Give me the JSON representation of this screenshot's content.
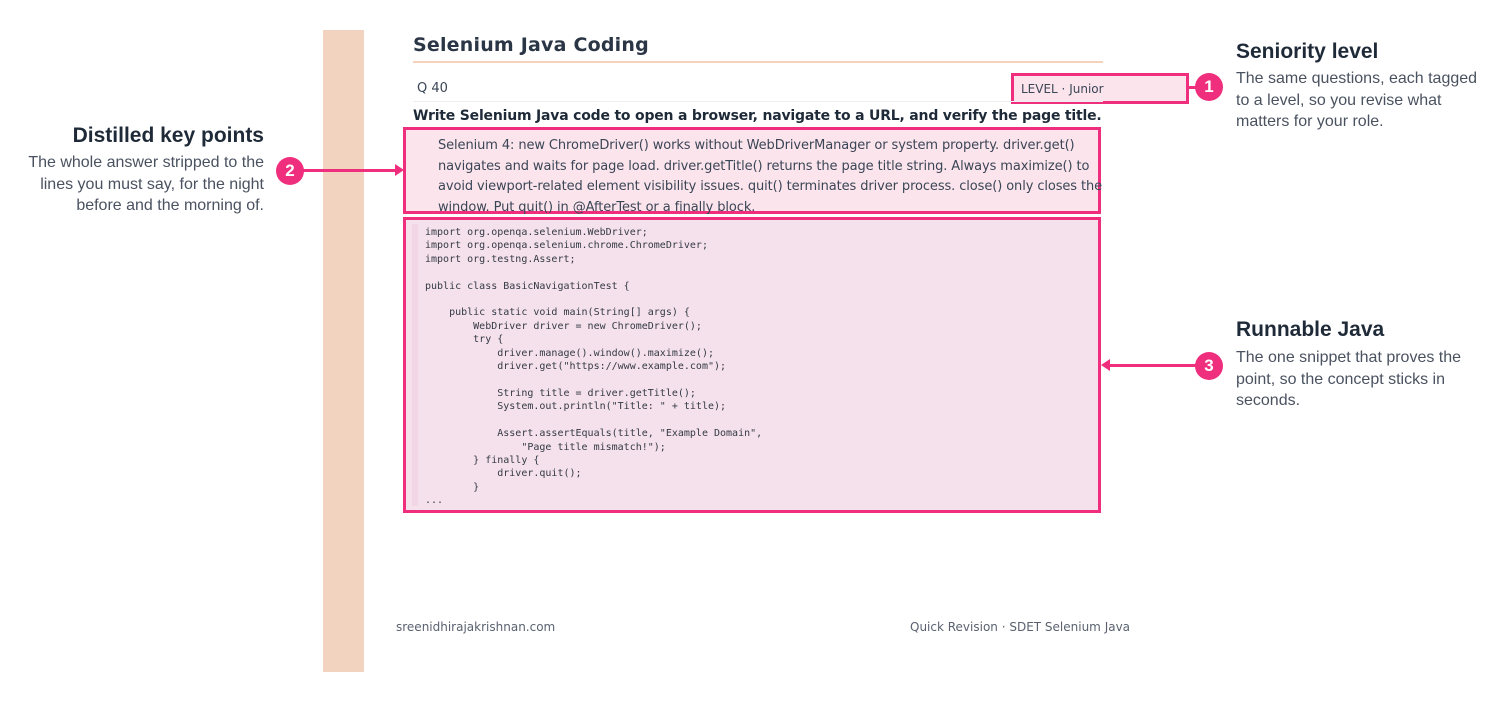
{
  "document": {
    "title": "Selenium Java Coding",
    "question_number": "Q 40",
    "level": "LEVEL · Junior",
    "question": "Write Selenium Java code to open a browser, navigate to a URL, and verify the page title.",
    "answer": "Selenium 4: new ChromeDriver() works without WebDriverManager or system property. driver.get() navigates and waits for page load. driver.getTitle() returns the page title string. Always maximize() to avoid viewport-related element visibility issues. quit() terminates driver process. close() only closes the window. Put quit() in @AfterTest or a finally block.",
    "code": "import org.openqa.selenium.WebDriver;\nimport org.openqa.selenium.chrome.ChromeDriver;\nimport org.testng.Assert;\n\npublic class BasicNavigationTest {\n\n    public static void main(String[] args) {\n        WebDriver driver = new ChromeDriver();\n        try {\n            driver.manage().window().maximize();\n            driver.get(\"https://www.example.com\");\n\n            String title = driver.getTitle();\n            System.out.println(\"Title: \" + title);\n\n            Assert.assertEquals(title, \"Example Domain\",\n                \"Page title mismatch!\");\n        } finally {\n            driver.quit();\n        }\n...",
    "footer_left": "sreenidhirajakrishnan.com",
    "footer_right": "Quick Revision · SDET Selenium Java"
  },
  "callouts": {
    "seniority": {
      "number": "1",
      "title": "Seniority level",
      "body": "The same questions, each tagged to a level, so you revise what matters for your role."
    },
    "key_points": {
      "number": "2",
      "title": "Distilled key points",
      "body": "The whole answer stripped to the lines you must say, for the night before and the morning of."
    },
    "java": {
      "number": "3",
      "title": "Runnable Java",
      "body": "The one snippet that proves the point, so the concept sticks in seconds."
    }
  },
  "colors": {
    "accent": "#ef2f7e",
    "highlight_fill": "#fce4ec",
    "side_bar": "#f1d3bf",
    "heading": "#1f2a38"
  }
}
